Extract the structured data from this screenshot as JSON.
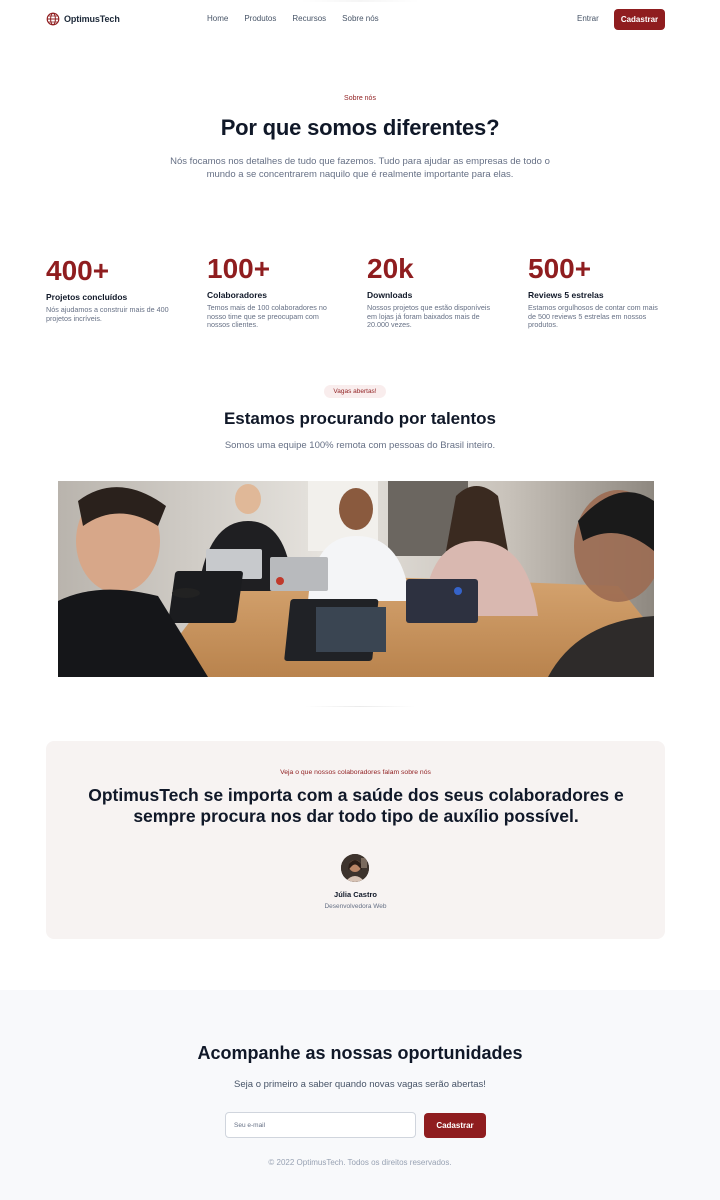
{
  "nav": {
    "logo_text": "OptimusTech",
    "links": [
      "Home",
      "Produtos",
      "Recursos",
      "Sobre nós"
    ],
    "login": "Entrar",
    "signup": "Cadastrar"
  },
  "about": {
    "eyebrow": "Sobre nós",
    "title": "Por que somos diferentes?",
    "description": "Nós focamos nos detalhes de tudo que fazemos. Tudo para ajudar as empresas de todo o mundo a se concentrarem naquilo que é realmente importante para elas."
  },
  "stats": [
    {
      "value": "400+",
      "label": "Projetos concluídos",
      "desc": "Nós ajudamos a construir mais de 400 projetos incríveis."
    },
    {
      "value": "100+",
      "label": "Colaboradores",
      "desc": "Temos mais de 100 colaboradores no nosso time que se preocupam com nossos clientes."
    },
    {
      "value": "20k",
      "label": "Downloads",
      "desc": "Nossos projetos que estão disponíveis em lojas já foram baixados mais de 20.000 vezes."
    },
    {
      "value": "500+",
      "label": "Reviews 5 estrelas",
      "desc": "Estamos orgulhosos de contar com mais de 500 reviews 5 estrelas em nossos produtos."
    }
  ],
  "jobs": {
    "badge": "Vagas abertas!",
    "title": "Estamos procurando por talentos",
    "subtitle": "Somos uma equipe 100% remota com pessoas do Brasil inteiro."
  },
  "testimonial": {
    "eyebrow": "Veja o que nossos colaboradores falam sobre nós",
    "quote": "OptimusTech se importa com a saúde dos seus colaboradores e sempre procura nos dar todo tipo de auxílio possível.",
    "name": "Júlia Castro",
    "role": "Desenvolvedora Web"
  },
  "newsletter": {
    "title": "Acompanhe as nossas oportunidades",
    "subtitle": "Seja o primeiro a saber quando novas vagas serão abertas!",
    "email_placeholder": "Seu e-mail",
    "button": "Cadastrar",
    "copyright": "© 2022 OptimusTech. Todos os direitos reservados."
  },
  "colors": {
    "brand": "#8f1d1f",
    "heading": "#101828",
    "muted": "#667085",
    "testimonial_bg": "#f7f3f2",
    "footer_bg": "#f8f9fb"
  }
}
